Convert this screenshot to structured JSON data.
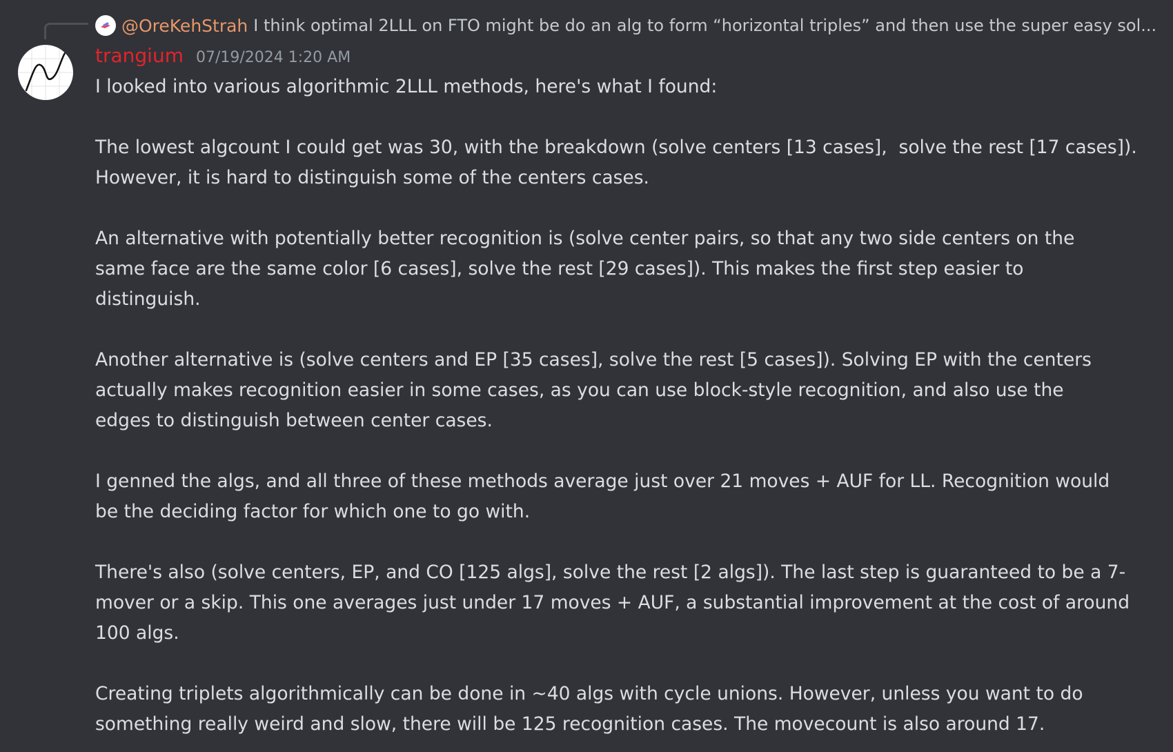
{
  "reply": {
    "author": "@OreKehStrah",
    "preview": "I think optimal 2LLL on FTO might be do an alg to form “horizontal triples” and then use the super easy sol..."
  },
  "message": {
    "username": "trangium",
    "timestamp": "07/19/2024 1:20 AM",
    "paragraphs": [
      "I looked into various algorithmic 2LLL methods, here's what I found:",
      "The lowest algcount I could get was 30, with the breakdown (solve centers [13 cases],  solve the rest [17 cases]).\nHowever, it is hard to distinguish some of the centers cases.",
      "An alternative with potentially better recognition is (solve center pairs, so that any two side centers on the\nsame face are the same color [6 cases], solve the rest [29 cases]). This makes the first step easier to\ndistinguish.",
      "Another alternative is (solve centers and EP [35 cases], solve the rest [5 cases]). Solving EP with the centers\nactually makes recognition easier in some cases, as you can use block-style recognition, and also use the\nedges to distinguish between center cases.",
      "I genned the algs, and all three of these methods average just over 21 moves + AUF for LL. Recognition would\nbe the deciding factor for which one to go with.",
      "There's also (solve centers, EP, and CO [125 algs], solve the rest [2 algs]). The last step is guaranteed to be a 7-\nmover or a skip. This one averages just under 17 moves + AUF, a substantial improvement at the cost of around\n100 algs.",
      "Creating triplets algorithmically can be done in ~40 algs with cycle unions. However, unless you want to do\nsomething really weird and slow, there will be 125 recognition cases. The movecount is also around 17."
    ]
  },
  "colors": {
    "background": "#313338",
    "reply_author": "#e8976a",
    "username": "#e4232b",
    "text": "#dbdee1",
    "timestamp": "#949ba4"
  }
}
